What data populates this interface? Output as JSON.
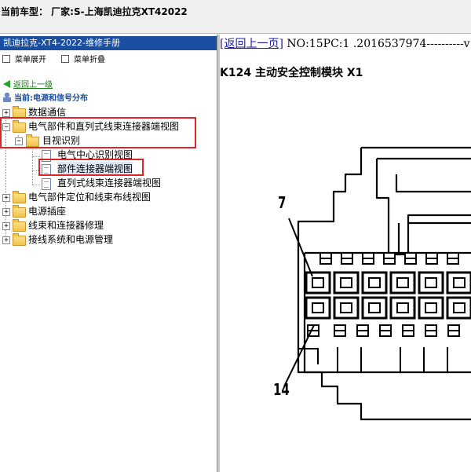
{
  "window": {
    "title": "当前车型：  厂家:S-上海凯迪拉克XT42022"
  },
  "left_panel": {
    "header": "凯迪拉克-XT4-2022-维修手册",
    "menu": {
      "expand_label": "菜单展开",
      "collapse_label": "菜单折叠"
    },
    "nav": {
      "back_label": "返回上一级",
      "current_label": "当前:电源和信号分布"
    },
    "tree": {
      "items": [
        {
          "label": "数据通信"
        },
        {
          "label": "电气部件和直列式线束连接器端视图"
        },
        {
          "label": "目视识别"
        },
        {
          "label": "电气中心识别视图"
        },
        {
          "label": "部件连接器端视图"
        },
        {
          "label": "直列式线束连接器端视图"
        },
        {
          "label": "电气部件定位和线束布线视图"
        },
        {
          "label": "电源插座"
        },
        {
          "label": "线束和连接器修理"
        },
        {
          "label": "接线系统和电源管理"
        }
      ]
    }
  },
  "right_panel": {
    "back_link": "[返回上一页]",
    "doc_info": " NO:15PC:1 .2016537974----------v",
    "title": "K124 主动安全控制模块 X1",
    "diagram": {
      "pin_label_top": "7",
      "pin_label_bottom": "14"
    }
  },
  "colors": {
    "header_bg": "#1a4ea0",
    "highlight_border": "#d9262c",
    "link": "#1a1aa6"
  }
}
